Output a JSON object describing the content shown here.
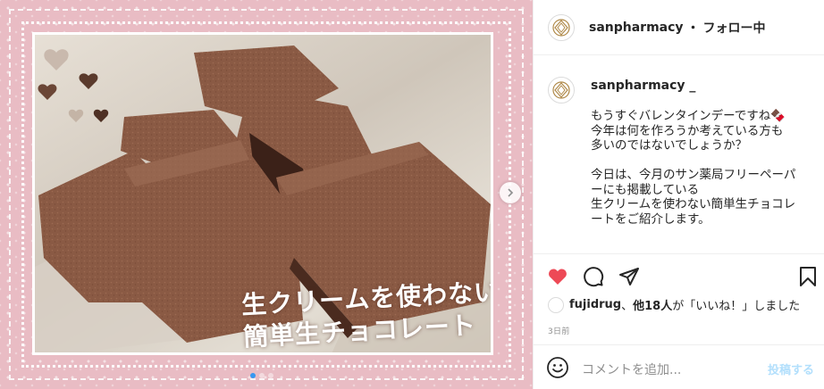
{
  "media": {
    "caption_line1": "生クリームを使わない！",
    "caption_line2": "簡単生チョコレート",
    "next_icon": "chevron-right-icon",
    "carousel_count": 3,
    "carousel_active": 1
  },
  "header": {
    "username": "sanpharmacy",
    "separator": "・",
    "follow_status": "フォロー中"
  },
  "comment": {
    "username": "sanpharmacy _",
    "body": "もうすぐバレンタインデーですね🍫\n今年は何を作ろうか考えている方も\n多いのではないでしょうか？\n\n今日は、今月のサン薬局フリーペーパ\nーにも掲載している\n生クリームを使わない簡単生チョコレ\nートをご紹介します。"
  },
  "actions": {
    "like_icon": "heart-icon",
    "comment_icon": "comment-icon",
    "share_icon": "share-icon",
    "save_icon": "bookmark-icon",
    "liked": true,
    "like_color": "#ed4956"
  },
  "likes": {
    "user": "fujidrug",
    "sep": "、",
    "others": "他18人",
    "suffix": "が「いいね！」しました"
  },
  "timestamp": "3日前",
  "add_comment": {
    "placeholder": "コメントを追加...",
    "post_label": "投稿する"
  }
}
